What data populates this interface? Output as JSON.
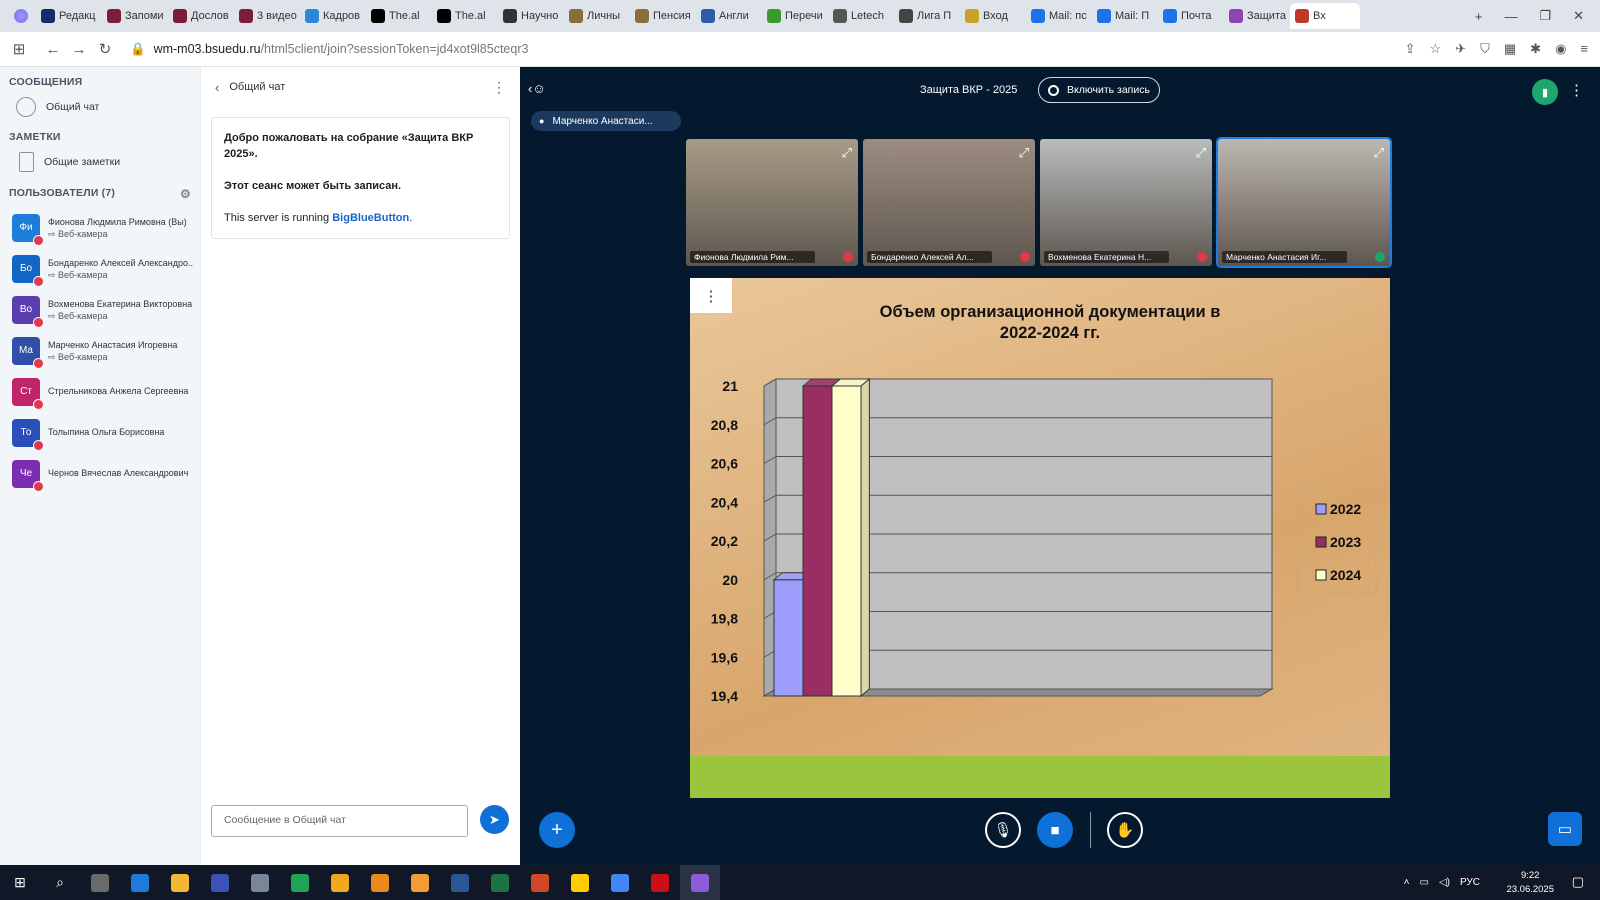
{
  "browser": {
    "tabs": [
      {
        "label": "Редакц",
        "color": "#1b2a6b"
      },
      {
        "label": "Запоми",
        "color": "#7a1e3a"
      },
      {
        "label": "Дослов",
        "color": "#7a1e3a"
      },
      {
        "label": "3 видео",
        "color": "#7a1e3a"
      },
      {
        "label": "Кадров",
        "color": "#2b88d8"
      },
      {
        "label": "The.al",
        "color": "#000000"
      },
      {
        "label": "The.al",
        "color": "#000000"
      },
      {
        "label": "Научно",
        "color": "#333333"
      },
      {
        "label": "Личны",
        "color": "#8a6d3b"
      },
      {
        "label": "Пенсия",
        "color": "#8a6d3b"
      },
      {
        "label": "Англи",
        "color": "#2e5ba8"
      },
      {
        "label": "Перечи",
        "color": "#3a9c2e"
      },
      {
        "label": "Letech",
        "color": "#555555"
      },
      {
        "label": "Лига П",
        "color": "#444444"
      },
      {
        "label": "Вход",
        "color": "#c8a227"
      },
      {
        "label": "Mail: пс",
        "color": "#1a73e8"
      },
      {
        "label": "Mail: П",
        "color": "#1a73e8"
      },
      {
        "label": "Почта",
        "color": "#1a73e8"
      },
      {
        "label": "Защита",
        "color": "#8e44ad"
      },
      {
        "label": "Вх",
        "color": "#c0392b"
      }
    ],
    "url_host": "wm-m03.bsuedu.ru",
    "url_path": "/html5client/join?sessionToken=jd4xot9l85cteqr3"
  },
  "left": {
    "messages_header": "СООБЩЕНИЯ",
    "public_chat": "Общий чат",
    "notes_header": "ЗАМЕТКИ",
    "shared_notes": "Общие заметки",
    "users_header": "ПОЛЬЗОВАТЕЛИ (7)",
    "users": [
      {
        "initials": "Фи",
        "name": "Фионова Людмила Римовна (Вы)",
        "sub": "Веб-камера",
        "color": "#1d7ed8"
      },
      {
        "initials": "Бо",
        "name": "Бондаренко Алексей Александро...",
        "sub": "Веб-камера",
        "color": "#1266c4"
      },
      {
        "initials": "Во",
        "name": "Вохменова Екатерина Викторовна",
        "sub": "Веб-камера",
        "color": "#5b3fb0"
      },
      {
        "initials": "Ма",
        "name": "Марченко Анастасия Игоревна",
        "sub": "Веб-камера",
        "color": "#2f4fa8"
      },
      {
        "initials": "Ст",
        "name": "Стрельникова Анжела Сергеевна",
        "sub": "",
        "color": "#c0246a"
      },
      {
        "initials": "То",
        "name": "Толыпина Ольга Борисовна",
        "sub": "",
        "color": "#2b4fb8"
      },
      {
        "initials": "Че",
        "name": "Чернов Вячеслав Александрович",
        "sub": "",
        "color": "#7b2fb0"
      }
    ]
  },
  "chat": {
    "title": "Общий чат",
    "welcome": "Добро пожаловать на собрание «Защита ВКР 2025».",
    "recording_note": "Этот сеанс может быть записан.",
    "server_prefix": "This server is running ",
    "server_link": "BigBlueButton",
    "server_suffix": ".",
    "input_placeholder": "Сообщение в Общий чат"
  },
  "meeting": {
    "name": "Защита ВКР - 2025",
    "record_label": "Включить запись",
    "talking": "Марченко Анастаси..."
  },
  "videos": [
    {
      "label": "Фионова Людмила Рим...",
      "tone": "#a89c88"
    },
    {
      "label": "Бондаренко Алексей Ал...",
      "tone": "#9d8c80"
    },
    {
      "label": "Вохменова Екатерина Н...",
      "tone": "#b9bcbd"
    },
    {
      "label": "Марченко Анастасия Иг...",
      "tone": "#bcb7b0"
    }
  ],
  "slide": {
    "title_line1": "Объем организационной документации в",
    "title_line2": "2022-2024 гг."
  },
  "chart_data": {
    "type": "bar",
    "categories": [
      ""
    ],
    "series": [
      {
        "name": "2022",
        "values": [
          20.0
        ],
        "color": "#9d9dfb"
      },
      {
        "name": "2023",
        "values": [
          21.0
        ],
        "color": "#992e62"
      },
      {
        "name": "2024",
        "values": [
          21.0
        ],
        "color": "#ffffcc"
      }
    ],
    "yticks": [
      "21",
      "20,8",
      "20,6",
      "20,4",
      "20,2",
      "20",
      "19,8",
      "19,6",
      "19,4"
    ],
    "ylim": [
      19.4,
      21
    ],
    "legend": "right",
    "grid": true
  },
  "taskbar": {
    "lang": "РУС",
    "time": "9:22",
    "date": "23.06.2025"
  }
}
